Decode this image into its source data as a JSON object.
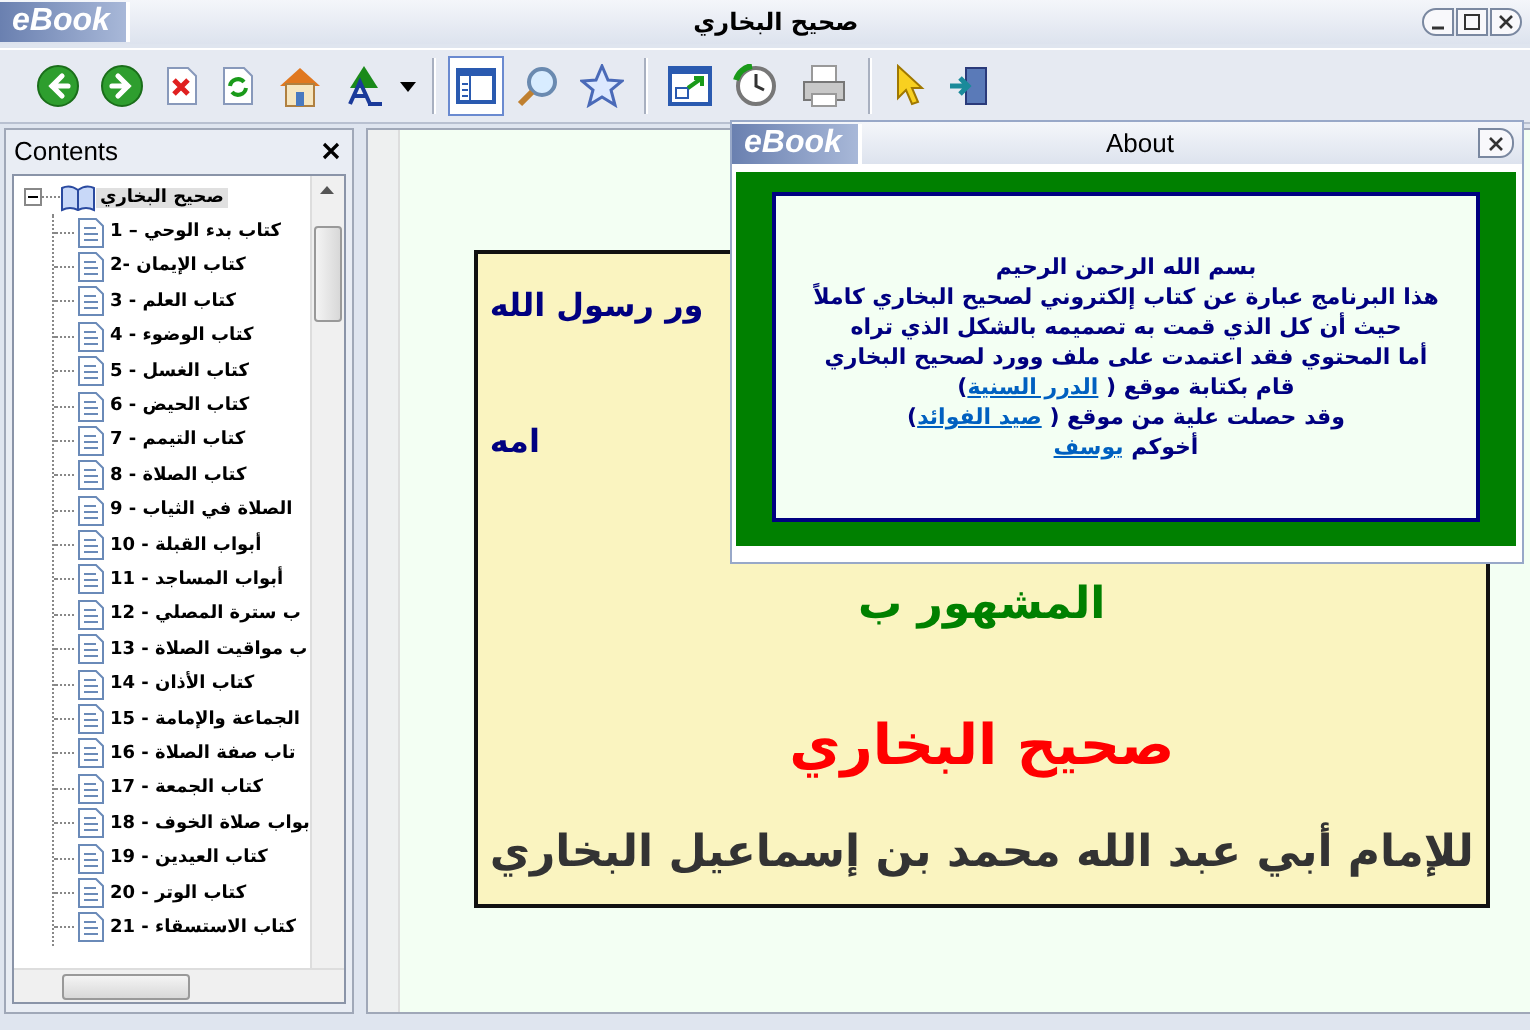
{
  "window": {
    "logo": "eBook",
    "title": "صحيح البخاري"
  },
  "toolbar": [
    {
      "kind": "back",
      "pressed": false
    },
    {
      "kind": "forward",
      "pressed": false
    },
    {
      "kind": "close-doc",
      "pressed": false
    },
    {
      "kind": "refresh",
      "pressed": false
    },
    {
      "kind": "home",
      "pressed": false
    },
    {
      "kind": "font",
      "pressed": false
    },
    {
      "kind": "dropdown",
      "pressed": false
    },
    {
      "kind": "sep"
    },
    {
      "kind": "contents",
      "pressed": true
    },
    {
      "kind": "search",
      "pressed": false
    },
    {
      "kind": "favorites",
      "pressed": false
    },
    {
      "kind": "sep"
    },
    {
      "kind": "resize",
      "pressed": false
    },
    {
      "kind": "history",
      "pressed": false
    },
    {
      "kind": "print",
      "pressed": false
    },
    {
      "kind": "sep"
    },
    {
      "kind": "pointer",
      "pressed": false
    },
    {
      "kind": "exit",
      "pressed": false
    }
  ],
  "sidebar": {
    "title": "Contents",
    "tree": {
      "label": "صحيح البخاري",
      "expanded": true,
      "children": [
        {
          "label": "كتاب بدء الوحي – 1"
        },
        {
          "label": "كتاب الإيمان -2"
        },
        {
          "label": "كتاب العلم - 3"
        },
        {
          "label": "كتاب الوضوء - 4"
        },
        {
          "label": "كتاب الغسل - 5"
        },
        {
          "label": "كتاب الحيض - 6"
        },
        {
          "label": "كتاب التيمم - 7"
        },
        {
          "label": "كتاب الصلاة - 8"
        },
        {
          "label": "الصلاة في الثياب - 9"
        },
        {
          "label": "أبواب القبلة - 10"
        },
        {
          "label": "أبواب المساجد - 11"
        },
        {
          "label": "ب سترة المصلي - 12"
        },
        {
          "label": "ب مواقيت الصلاة - 13"
        },
        {
          "label": "كتاب الأذان - 14"
        },
        {
          "label": "الجماعة والإمامة - 15"
        },
        {
          "label": "تاب صفة الصلاة - 16"
        },
        {
          "label": "كتاب الجمعة - 17"
        },
        {
          "label": "بواب صلاة الخوف - 18"
        },
        {
          "label": "كتاب العيدين - 19"
        },
        {
          "label": "كتاب الوتر - 20"
        },
        {
          "label": "كتاب الاستسقاء - 21"
        }
      ]
    }
  },
  "document": {
    "lines": [
      {
        "text": "ور رسول الله",
        "kind": "covered",
        "color": "#000080"
      },
      {
        "text": "امه",
        "kind": "covered",
        "color": "#000080"
      },
      {
        "text": "المشهور ب",
        "kind": "full",
        "color": "#008000"
      },
      {
        "text": "صحيح البخاري",
        "kind": "full",
        "color": "#ff0000"
      },
      {
        "text": "للإمام أبي عبد الله محمد بن إسماعيل البخاري",
        "kind": "full",
        "color": "#333333"
      }
    ]
  },
  "about_dialog": {
    "logo": "eBook",
    "title": "About",
    "lines": [
      {
        "text": "بسم الله الرحمن الرحيم"
      },
      {
        "text": "هذا البرنامج عبارة عن كتاب إلكتروني لصحيح البخاري كاملاً"
      },
      {
        "text": "حيث أن كل الذي قمت به تصميمه بالشكل الذي تراه"
      },
      {
        "text": "أما المحتوي فقد اعتمدت على ملف وورد لصحيح البخاري"
      },
      {
        "text": "قام بكتابة موقع (",
        "link": "الدرر السنية",
        "after": ")"
      },
      {
        "text": "وقد حصلت علية من موقع (",
        "link": "صيد الفوائد",
        "after": ")"
      },
      {
        "text": "أخوكم",
        "link": "يوسف"
      }
    ]
  }
}
